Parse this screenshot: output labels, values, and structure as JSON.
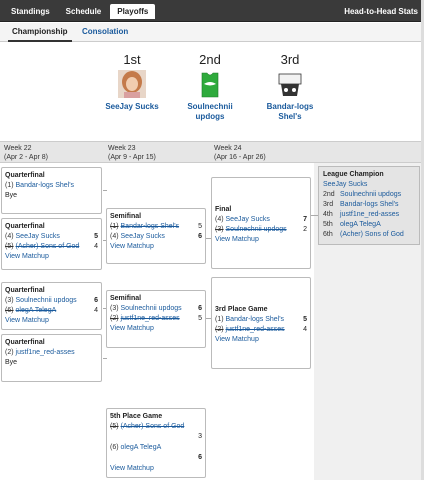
{
  "nav": {
    "items": [
      "Standings",
      "Schedule",
      "Playoffs"
    ],
    "active_index": 2,
    "head_to_head": "Head-to-Head Stats"
  },
  "subtabs": {
    "championship": "Championship",
    "consolation": "Consolation"
  },
  "podium": [
    {
      "place": "1st",
      "team": "SeeJay Sucks",
      "icon": "avatar-photo"
    },
    {
      "place": "2nd",
      "team_line1": "Soulnechnii",
      "team_line2": "updogs",
      "icon": "green-jersey-icon"
    },
    {
      "place": "3rd",
      "team_line1": "Bandar-logs",
      "team_line2": "Shel's",
      "icon": "team-logo"
    }
  ],
  "weeks": [
    {
      "title": "Week 22",
      "range": "(Apr 2 - Apr 8)"
    },
    {
      "title": "Week 23",
      "range": "(Apr 9 - Apr 15)"
    },
    {
      "title": "Week 24",
      "range": "(Apr 16 - Apr 26)"
    }
  ],
  "quarterfinals": [
    {
      "title": "Quarterfinal",
      "t1_seed": "(1)",
      "t1_name": "Bandar-logs Shel's",
      "bye": "Bye"
    },
    {
      "title": "Quarterfinal",
      "t1_seed": "(4)",
      "t1_name": "SeeJay Sucks",
      "t1_score": "5",
      "t2_seed": "(5)",
      "t2_name": "(Acher) Sons of God",
      "t2_score": "4",
      "view": "View Matchup"
    },
    {
      "title": "Quarterfinal",
      "t1_seed": "(3)",
      "t1_name": "Soulnechnii updogs",
      "t1_score": "6",
      "t2_seed": "(6)",
      "t2_name": "olegA TelegA",
      "t2_score": "4",
      "view": "View Matchup"
    },
    {
      "title": "Quarterfinal",
      "t1_seed": "(2)",
      "t1_name": "justf1ne_red-asses",
      "bye": "Bye"
    }
  ],
  "semifinals": [
    {
      "title": "Semifinal",
      "t1_seed": "(1)",
      "t1_name": "Bandar-logs Shel's",
      "t1_score": "5",
      "t2_seed": "(4)",
      "t2_name": "SeeJay Sucks",
      "t2_score": "6",
      "view": "View Matchup"
    },
    {
      "title": "Semifinal",
      "t1_seed": "(3)",
      "t1_name": "Soulnechnii updogs",
      "t1_score": "6",
      "t2_seed": "(2)",
      "t2_name": "justf1ne_red-asses",
      "t2_score": "5",
      "view": "View Matchup"
    }
  ],
  "final": {
    "title": "Final",
    "t1_seed": "(4)",
    "t1_name": "SeeJay Sucks",
    "t1_score": "7",
    "t2_seed": "(3)",
    "t2_name": "Soulnechnii updogs",
    "t2_score": "2",
    "view": "View Matchup"
  },
  "third_place": {
    "title": "3rd Place Game",
    "t1_seed": "(1)",
    "t1_name": "Bandar-logs Shel's",
    "t1_score": "5",
    "t2_seed": "(2)",
    "t2_name": "justf1ne_red-asses",
    "t2_score": "4",
    "view": "View Matchup"
  },
  "fifth_place": {
    "title": "5th Place Game",
    "t1_seed": "(5)",
    "t1_name": "(Acher) Sons of God",
    "t1_score": "3",
    "t2_seed": "(6)",
    "t2_name": "olegA TelegA",
    "t2_score": "6",
    "view": "View Matchup"
  },
  "champion": {
    "title": "League Champion",
    "winner": "SeeJay Sucks",
    "standings": [
      {
        "rank": "2nd",
        "name": "Soulnechnii updogs"
      },
      {
        "rank": "3rd",
        "name": "Bandar-logs Shel's"
      },
      {
        "rank": "4th",
        "name": "justf1ne_red-asses"
      },
      {
        "rank": "5th",
        "name": "olegA TelegA"
      },
      {
        "rank": "6th",
        "name": "(Acher) Sons of God"
      }
    ]
  },
  "colors": {
    "link": "#1a5a9c",
    "topbar": "#3a3a3a",
    "jersey": "#2eaa3c"
  }
}
